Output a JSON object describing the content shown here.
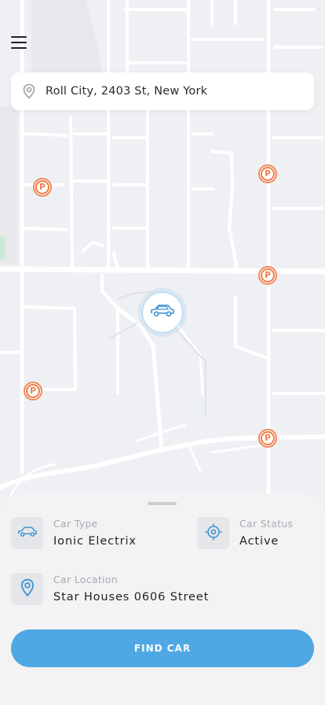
{
  "header": {
    "menu_icon": "hamburger-menu-icon"
  },
  "search": {
    "value": "Roll City, 2403 St, New York",
    "icon": "location-pin-icon"
  },
  "map": {
    "parking_label": "P",
    "parking_color": "#ef7d49",
    "car_marker_icon": "car-icon"
  },
  "sheet": {
    "car_type_label": "Car Type",
    "car_type_value": "Ionic Electrix",
    "car_status_label": "Car Status",
    "car_status_value": "Active",
    "car_location_label": "Car Location",
    "car_location_value": "Star Houses 0606 Street",
    "find_button": "FIND CAR",
    "accent_color": "#4fa8e4"
  }
}
